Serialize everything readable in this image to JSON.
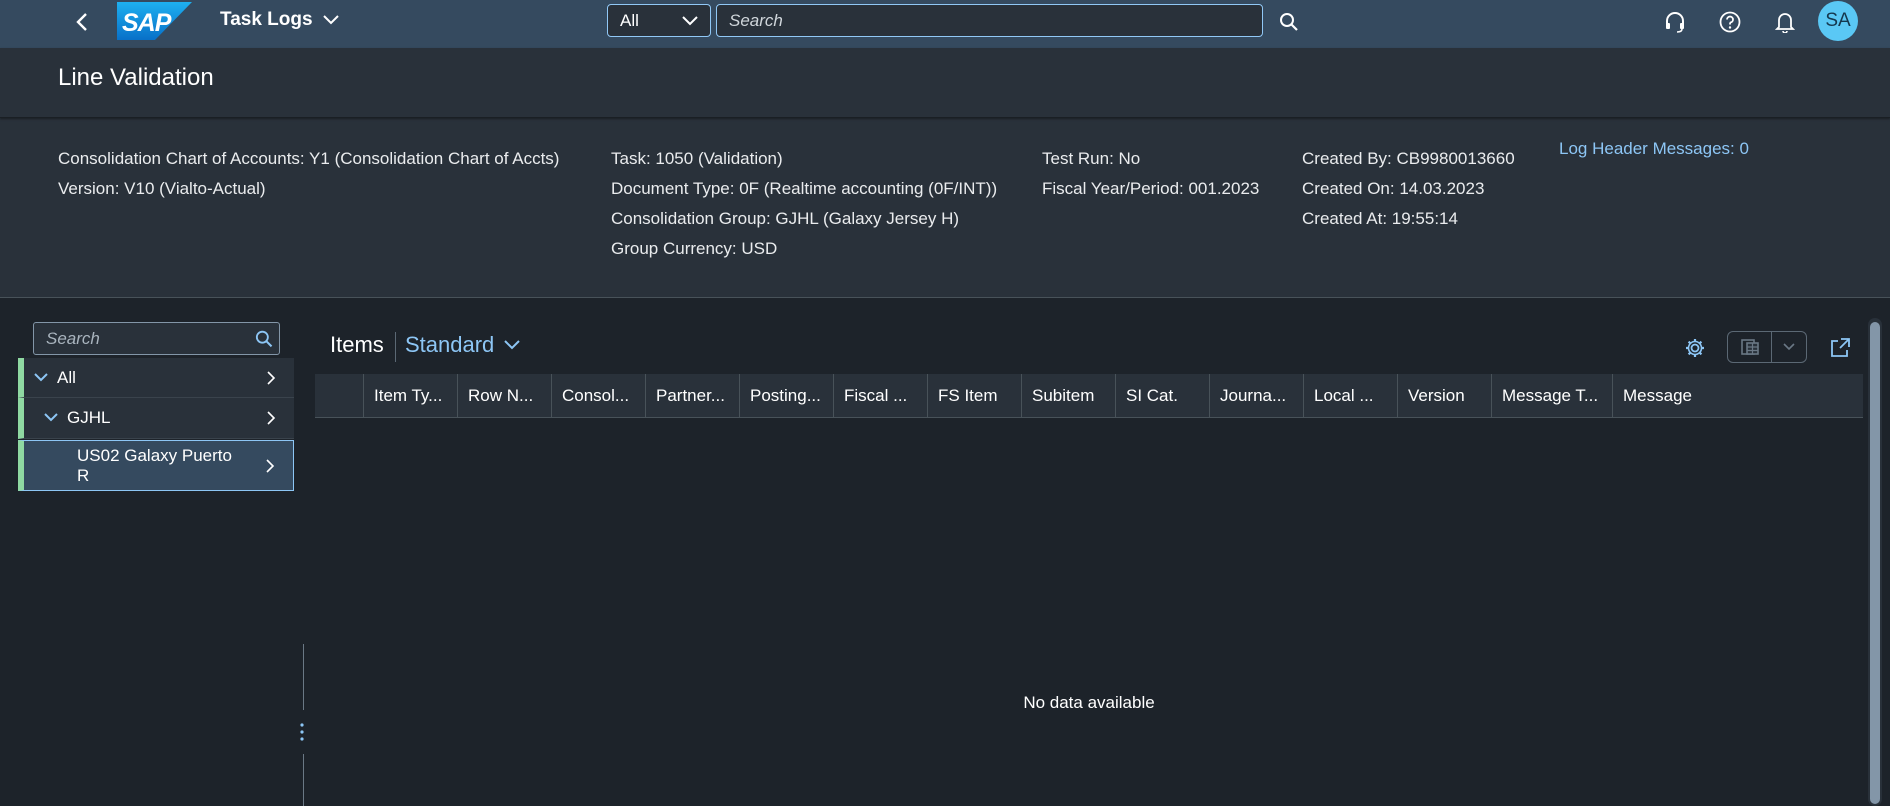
{
  "shell": {
    "app_title": "Task Logs",
    "scope_value": "All",
    "search_placeholder": "Search",
    "avatar_initials": "SA",
    "logo_text": "SAP"
  },
  "header": {
    "title": "Line Validation",
    "col1": [
      "Consolidation Chart of Accounts: Y1 (Consolidation Chart of Accts)",
      "Version: V10 (Vialto-Actual)"
    ],
    "col2": [
      "Task: 1050 (Validation)",
      "Document Type: 0F (Realtime accounting (0F/INT))",
      "Consolidation Group: GJHL (Galaxy Jersey H)",
      "Group Currency: USD"
    ],
    "col3": [
      "Test Run: No",
      "Fiscal Year/Period: 001.2023"
    ],
    "col4": [
      "Created By: CB9980013660",
      "Created On: 14.03.2023",
      "Created At: 19:55:14"
    ],
    "log_link": "Log Header Messages: 0"
  },
  "tree": {
    "search_placeholder": "Search",
    "items": [
      {
        "label": "All"
      },
      {
        "label": "GJHL"
      },
      {
        "label": "US02 Galaxy Puerto R"
      }
    ]
  },
  "table": {
    "title": "Items",
    "variant": "Standard",
    "columns": [
      "",
      "Item Ty...",
      "Row N...",
      "Consol...",
      "Partner...",
      "Posting...",
      "Fiscal ...",
      "FS Item",
      "Subitem",
      "SI Cat.",
      "Journa...",
      "Local ...",
      "Version",
      "Message T...",
      "Message"
    ],
    "no_data": "No data available"
  },
  "colors": {
    "shell_bg": "#354a5f",
    "header_bg": "#29313a",
    "page_bg": "#1d232a",
    "link": "#8dc6f5",
    "tree_status": "#8fd9a2",
    "avatar": "#5ac8f5"
  }
}
